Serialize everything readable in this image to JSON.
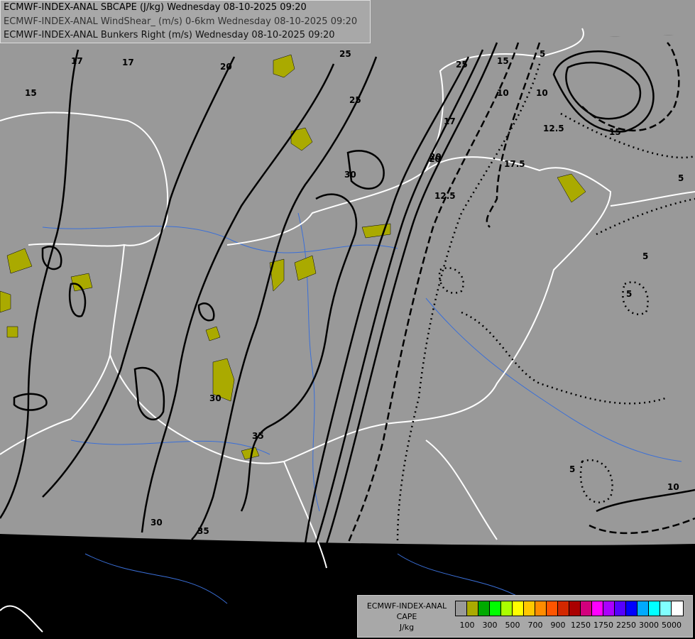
{
  "header": {
    "lines": [
      "ECMWF-INDEX-ANAL SBCAPE (J/kg) Wednesday 08-10-2025 09:20",
      "ECMWF-INDEX-ANAL WindShear_ (m/s) 0-6km Wednesday 08-10-2025 09:20",
      "ECMWF-INDEX-ANAL Bunkers Right (m/s) Wednesday 08-10-2025 09:20"
    ]
  },
  "map": {
    "background_color": "#999999",
    "outside_color": "#000000",
    "border_color": "#ffffff",
    "river_color": "#3a6fd8",
    "cape_fill_color": "#aaaa00",
    "contour_labels": [
      "17",
      "17",
      "15",
      "20",
      "25",
      "25",
      "25",
      "17",
      "20",
      "30",
      "30",
      "35",
      "35",
      "30",
      "15",
      "10",
      "10",
      "5",
      "12.5",
      "15",
      "17.5",
      "12.5",
      "5",
      "5",
      "5",
      "5",
      "10",
      "20"
    ]
  },
  "legend": {
    "title_lines": [
      "ECMWF-INDEX-ANAL",
      "CAPE",
      "J/kg"
    ],
    "colors": [
      "#999999",
      "#aaaa00",
      "#00aa00",
      "#00ff00",
      "#aaff00",
      "#ffff00",
      "#ffc800",
      "#ff8c00",
      "#ff5500",
      "#d22800",
      "#aa0000",
      "#d2007d",
      "#ff00ff",
      "#aa00ff",
      "#5500ff",
      "#0000ff",
      "#00aaff",
      "#00ffff",
      "#80ffff",
      "#ffffff"
    ],
    "tick_labels": [
      "100",
      "300",
      "500",
      "700",
      "900",
      "1250",
      "1750",
      "2250",
      "3000",
      "5000"
    ]
  }
}
